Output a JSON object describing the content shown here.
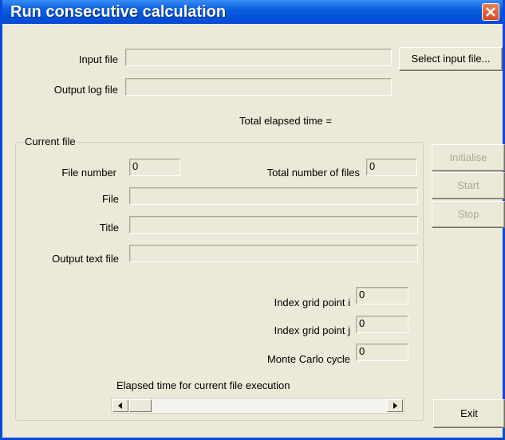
{
  "window": {
    "title": "Run consecutive calculation"
  },
  "labels": {
    "input_file": "Input file",
    "output_log_file": "Output log file",
    "total_elapsed": "Total elapsed time =",
    "current_file_group": "Current file",
    "file_number": "File number",
    "total_files": "Total number of files",
    "file": "File",
    "title": "Title",
    "output_text_file": "Output text file",
    "index_i": "Index grid point i",
    "index_j": "Index grid point j",
    "mc_cycle": "Monte Carlo cycle",
    "elapsed_current": "Elapsed time for current file execution"
  },
  "values": {
    "input_file": "",
    "output_log_file": "",
    "file_number": "0",
    "total_files": "0",
    "file": "",
    "title": "",
    "output_text_file": "",
    "index_i": "0",
    "index_j": "0",
    "mc_cycle": "0"
  },
  "buttons": {
    "select_input": "Select input file...",
    "initialise": "Initialise",
    "start": "Start",
    "stop": "Stop",
    "exit": "Exit"
  },
  "colors": {
    "titlebar": "#0a5fe0",
    "close": "#d9491c",
    "face": "#ece9d8"
  }
}
